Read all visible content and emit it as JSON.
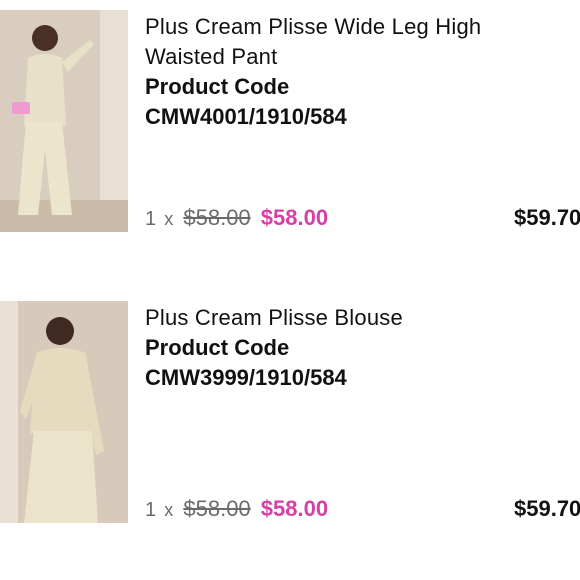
{
  "items": [
    {
      "name": "Plus Cream Plisse Wide Leg High Waisted Pant",
      "code_label": "Product Code",
      "code": "CMW4001/1910/584",
      "qty": "1",
      "times": "x",
      "old_price": "$58.00",
      "price": "$58.00",
      "total": "$59.70"
    },
    {
      "name": "Plus Cream Plisse Blouse",
      "code_label": "Product Code",
      "code": "CMW3999/1910/584",
      "qty": "1",
      "times": "x",
      "old_price": "$58.00",
      "price": "$58.00",
      "total": "$59.70"
    }
  ],
  "colors": {
    "sale": "#d63fa6",
    "muted": "#6b6b6b",
    "text": "#111111"
  }
}
